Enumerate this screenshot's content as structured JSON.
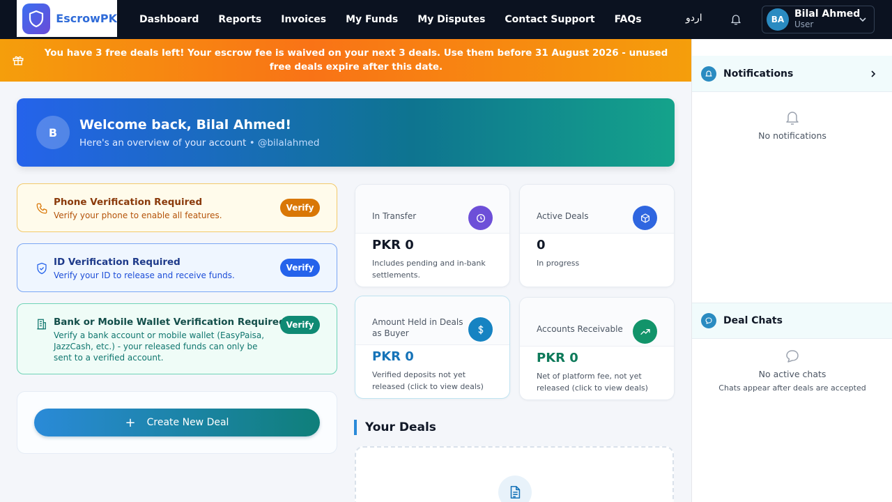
{
  "brand": {
    "name": "EscrowPK"
  },
  "nav": {
    "links": [
      "Dashboard",
      "Reports",
      "Invoices",
      "My Funds",
      "My Disputes",
      "Contact Support",
      "FAQs"
    ],
    "language": "اردو",
    "user": {
      "initials": "BA",
      "name": "Bilal Ahmed",
      "role": "User"
    }
  },
  "banner": {
    "text": "You have 3 free deals left! Your escrow fee is waived on your next 3 deals. Use them before 31 August 2026 - unused free deals expire after this date."
  },
  "welcome": {
    "initial": "B",
    "title": "Welcome back, Bilal Ahmed!",
    "subtitle": "Here's an overview of your account",
    "handle": "• @bilalahmed"
  },
  "verifications": {
    "phone": {
      "title": "Phone Verification Required",
      "desc": "Verify your phone to enable all features.",
      "button": "Verify"
    },
    "id": {
      "title": "ID Verification Required",
      "desc": "Verify your ID to release and receive funds.",
      "button": "Verify"
    },
    "bank": {
      "title": "Bank or Mobile Wallet Verification Required",
      "desc": "Verify a bank account or mobile wallet (EasyPaisa, JazzCash, etc.) - your released funds can only be sent to a verified account.",
      "button": "Verify"
    }
  },
  "create_deal": {
    "plus": "+",
    "label": "Create New Deal"
  },
  "stats": {
    "in_transfer": {
      "label": "In Transfer",
      "value": "PKR 0",
      "note": "Includes pending and in-bank settlements.",
      "color": "#6d4fd8"
    },
    "active_deals": {
      "label": "Active Deals",
      "value": "0",
      "note": "In progress",
      "color": "#2f66e0"
    },
    "held_buyer": {
      "label": "Amount Held in Deals as Buyer",
      "value": "PKR 0",
      "note": "Verified deposits not yet released (click to view deals)",
      "color": "#1683c2",
      "value_color": "#1673b8"
    },
    "receivable": {
      "label": "Accounts Receivable",
      "value": "PKR 0",
      "note": "Net of platform fee, not yet released (click to view deals)",
      "color": "#12946a",
      "value_color": "#0e7a5a"
    }
  },
  "deals": {
    "title": "Your Deals"
  },
  "sidebar": {
    "notifications": {
      "title": "Notifications",
      "empty": "No notifications"
    },
    "chats": {
      "title": "Deal Chats",
      "empty": "No active chats",
      "empty_sub": "Chats appear after deals are accepted"
    }
  }
}
